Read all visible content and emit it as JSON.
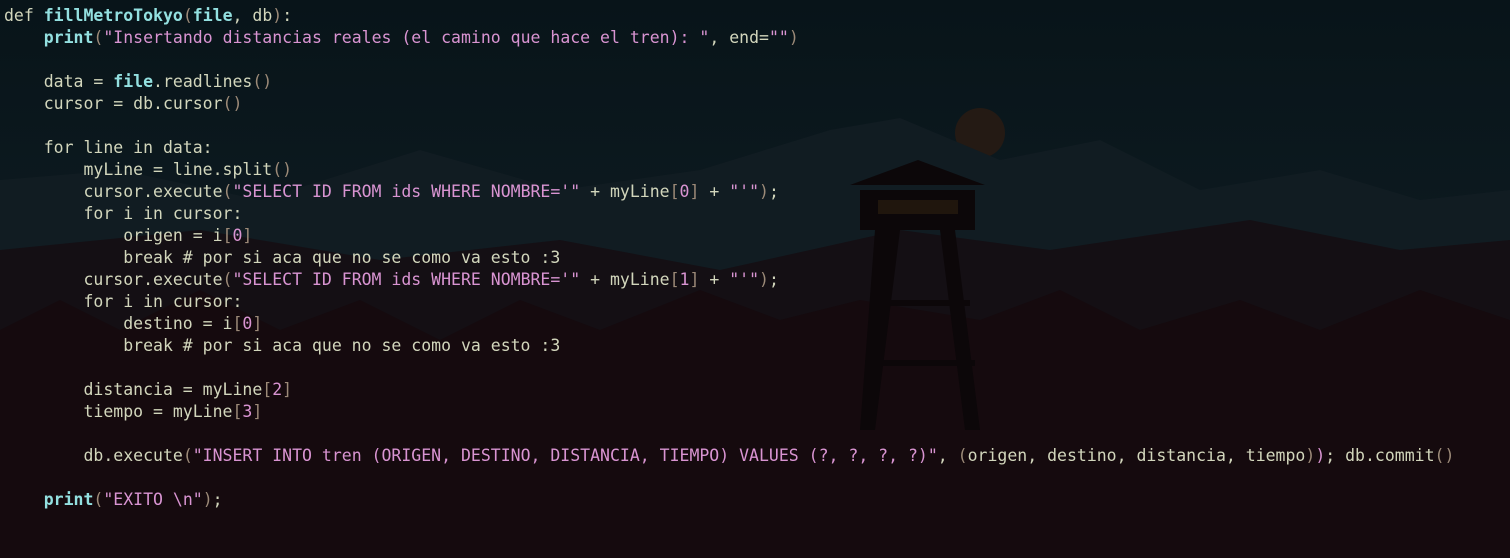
{
  "editor": {
    "language": "python",
    "colors": {
      "background": "#0a1016",
      "text": "#d2d6bc",
      "builtin": "#93e0e0",
      "string": "#d994d2",
      "bracket": "#9c8a78"
    },
    "lines": [
      [
        [
          "t",
          "def "
        ],
        [
          "b",
          "fillMetroTokyo"
        ],
        [
          "p",
          "("
        ],
        [
          "b",
          "file"
        ],
        [
          "t",
          ", db"
        ],
        [
          "p",
          ")"
        ],
        [
          "t",
          ":"
        ]
      ],
      [
        [
          "t",
          "    "
        ],
        [
          "b",
          "print"
        ],
        [
          "p",
          "("
        ],
        [
          "s",
          "\"Insertando distancias reales (el camino que hace el tren): \""
        ],
        [
          "t",
          ", end="
        ],
        [
          "s",
          "\"\""
        ],
        [
          "p",
          ")"
        ]
      ],
      [],
      [
        [
          "t",
          "    data = "
        ],
        [
          "b",
          "file"
        ],
        [
          "t",
          ".readlines"
        ],
        [
          "p",
          "()"
        ]
      ],
      [
        [
          "t",
          "    cursor = db.cursor"
        ],
        [
          "p",
          "()"
        ]
      ],
      [],
      [
        [
          "t",
          "    for line in data:"
        ]
      ],
      [
        [
          "t",
          "        myLine = line.split"
        ],
        [
          "p",
          "()"
        ]
      ],
      [
        [
          "t",
          "        cursor.execute"
        ],
        [
          "p",
          "("
        ],
        [
          "s",
          "\"SELECT ID FROM ids WHERE NOMBRE='\""
        ],
        [
          "t",
          " + myLine"
        ],
        [
          "p",
          "["
        ],
        [
          "n",
          "0"
        ],
        [
          "p",
          "]"
        ],
        [
          "t",
          " + "
        ],
        [
          "s",
          "\"'\""
        ],
        [
          "p",
          ")"
        ],
        [
          "t",
          ";"
        ]
      ],
      [
        [
          "t",
          "        for i in cursor:"
        ]
      ],
      [
        [
          "t",
          "            origen = i"
        ],
        [
          "p",
          "["
        ],
        [
          "n",
          "0"
        ],
        [
          "p",
          "]"
        ]
      ],
      [
        [
          "t",
          "            break # por si aca que no se como va esto :3"
        ]
      ],
      [
        [
          "t",
          "        cursor.execute"
        ],
        [
          "p",
          "("
        ],
        [
          "s",
          "\"SELECT ID FROM ids WHERE NOMBRE='\""
        ],
        [
          "t",
          " + myLine"
        ],
        [
          "p",
          "["
        ],
        [
          "n",
          "1"
        ],
        [
          "p",
          "]"
        ],
        [
          "t",
          " + "
        ],
        [
          "s",
          "\"'\""
        ],
        [
          "p",
          ")"
        ],
        [
          "t",
          ";"
        ]
      ],
      [
        [
          "t",
          "        for i in cursor:"
        ]
      ],
      [
        [
          "t",
          "            destino = i"
        ],
        [
          "p",
          "["
        ],
        [
          "n",
          "0"
        ],
        [
          "p",
          "]"
        ]
      ],
      [
        [
          "t",
          "            break # por si aca que no se como va esto :3"
        ]
      ],
      [],
      [
        [
          "t",
          "        distancia = myLine"
        ],
        [
          "p",
          "["
        ],
        [
          "n",
          "2"
        ],
        [
          "p",
          "]"
        ]
      ],
      [
        [
          "t",
          "        tiempo = myLine"
        ],
        [
          "p",
          "["
        ],
        [
          "n",
          "3"
        ],
        [
          "p",
          "]"
        ]
      ],
      [],
      [
        [
          "t",
          "        db.execute"
        ],
        [
          "p",
          "("
        ],
        [
          "s",
          "\"INSERT INTO tren (ORIGEN, DESTINO, DISTANCIA, TIEMPO) VALUES (?, ?, ?, ?)\""
        ],
        [
          "t",
          ", "
        ],
        [
          "p",
          "("
        ],
        [
          "t",
          "origen, destino, distancia, tiempo"
        ],
        [
          "p",
          ")"
        ],
        [
          "s",
          ")"
        ],
        [
          "t",
          "; db.commit"
        ],
        [
          "p",
          "()"
        ]
      ],
      [],
      [
        [
          "t",
          "    "
        ],
        [
          "b",
          "print"
        ],
        [
          "p",
          "("
        ],
        [
          "s",
          "\"EXITO \\n\""
        ],
        [
          "p",
          ")"
        ],
        [
          "t",
          ";"
        ]
      ]
    ]
  }
}
